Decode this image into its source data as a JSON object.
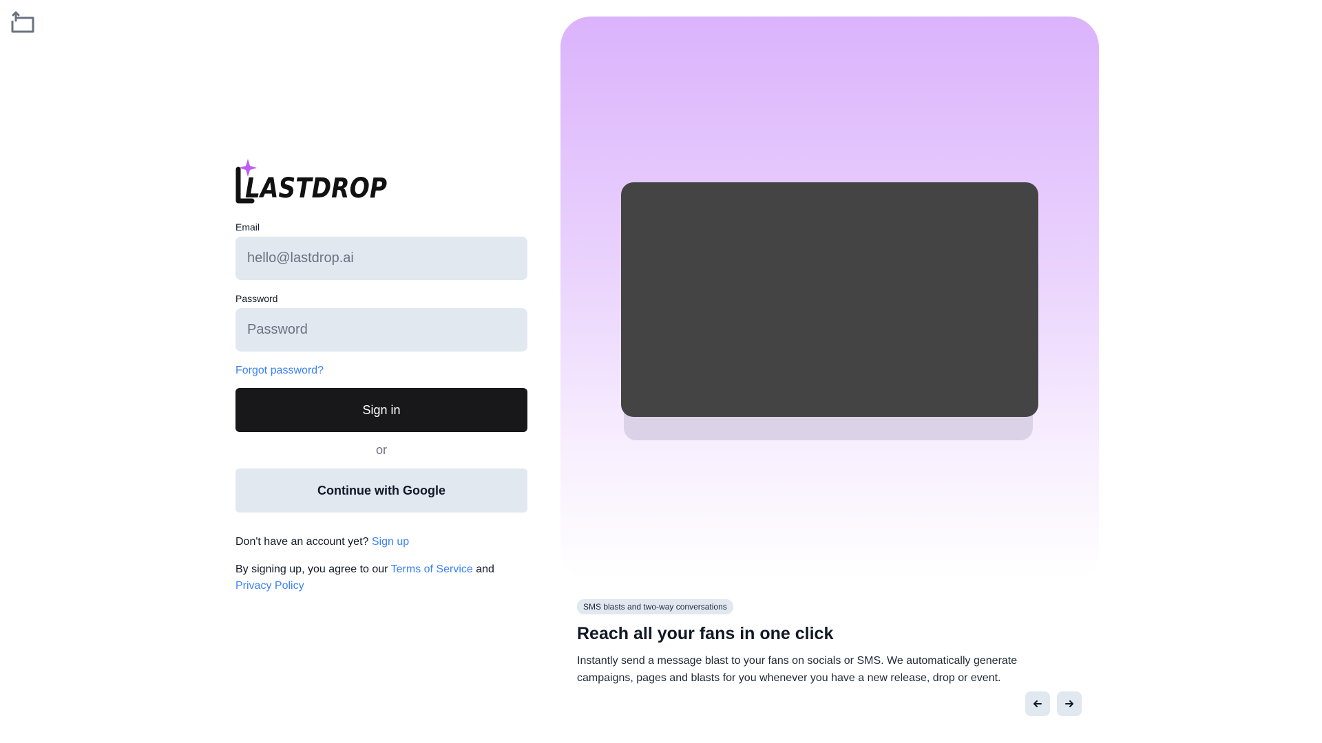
{
  "icons": {
    "corner": "rewind-frame-icon",
    "prev": "arrow-left-icon",
    "next": "arrow-right-icon",
    "logo_star": "sparkle-star-icon"
  },
  "colors": {
    "accent_link": "#3b82f6",
    "primary_button": "#18181b",
    "input_bg": "#e2e8f0",
    "showcase_top": "#dbb3fc",
    "logo_star": "#c05cf5",
    "video_placeholder": "#444444"
  },
  "login": {
    "logo_text": "LASTDROP",
    "email_label": "Email",
    "email_placeholder": "hello@lastdrop.ai",
    "email_value": "",
    "password_label": "Password",
    "password_placeholder": "Password",
    "password_value": "",
    "forgot_link": "Forgot password?",
    "sign_in_button": "Sign in",
    "or_text": "or",
    "google_button": "Continue with Google",
    "signup_prompt": "Don't have an account yet?",
    "signup_link": "Sign up",
    "legal_prefix": "By signing up, you agree to our",
    "terms_link": "Terms of Service",
    "legal_and": "and",
    "privacy_link": "Privacy Policy"
  },
  "showcase": {
    "badge": "SMS blasts and two-way conversations",
    "title": "Reach all your fans in one click",
    "description": "Instantly send a message blast to your fans on socials or SMS. We automatically generate campaigns, pages and blasts for you whenever you have a new release, drop or event."
  }
}
